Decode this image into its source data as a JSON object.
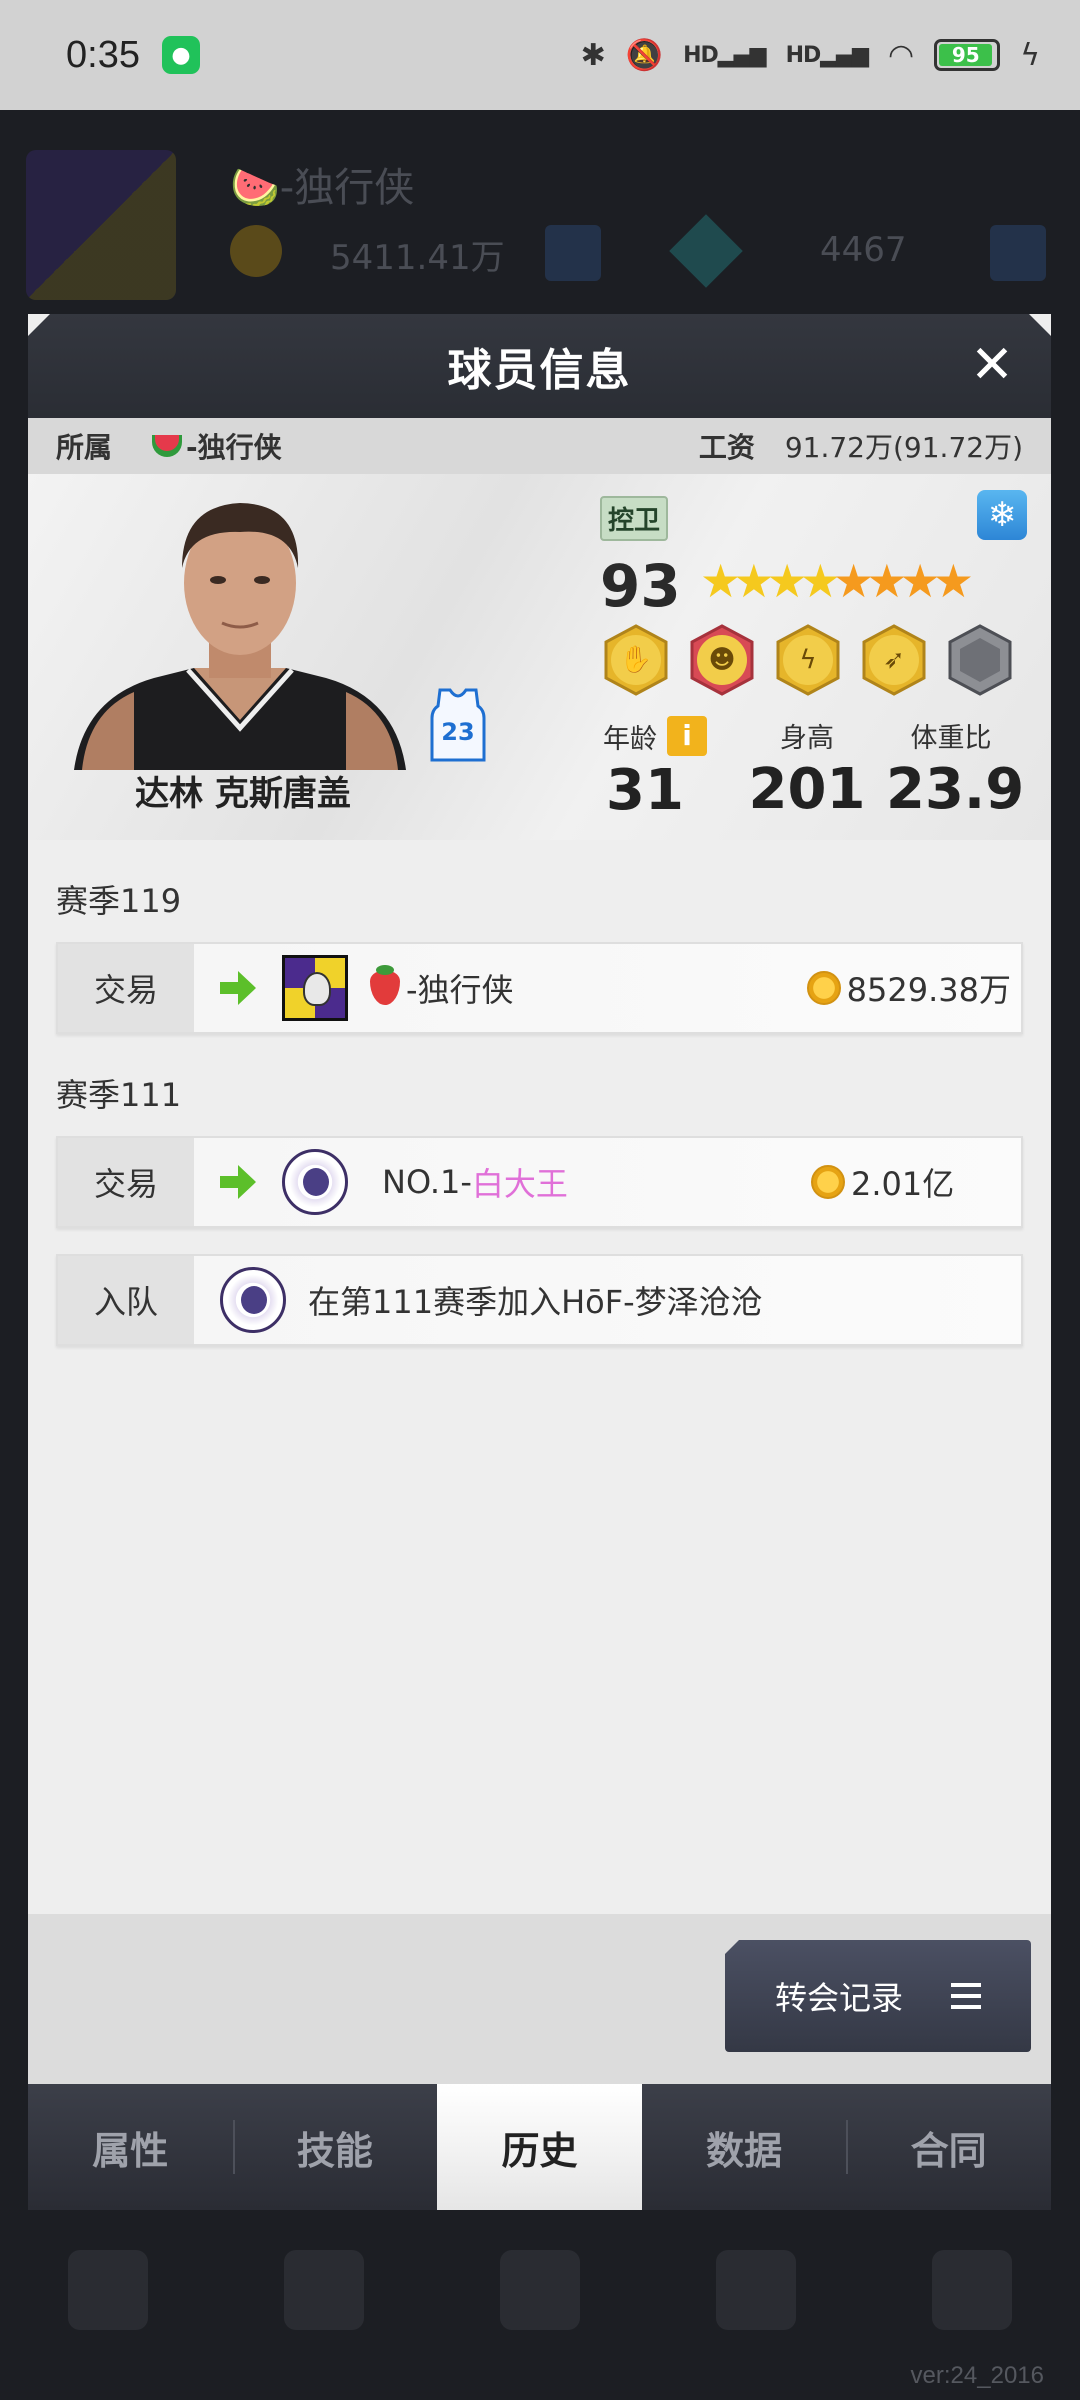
{
  "status_bar": {
    "time": "0:35",
    "network_1": "HD",
    "network_2": "HD",
    "battery": "95"
  },
  "background": {
    "team_name": "🍉-独行侠",
    "money": "5411.41万",
    "gems": "4467",
    "version": "ver:24_2016"
  },
  "dialog": {
    "title": "球员信息",
    "close_symbol": "✕",
    "affiliation_label": "所属",
    "affiliation_team": "-独行侠",
    "salary_label": "工资",
    "salary_value": "91.72万(91.72万)"
  },
  "player": {
    "name": "达林 克斯唐盖",
    "jersey_number": "23",
    "position": "控卫",
    "overall": "93",
    "stars_filled": 4,
    "stars_total": 8,
    "age_label": "年龄",
    "age": "31",
    "height_label": "身高",
    "height": "201",
    "weight_ratio_label": "体重比",
    "weight_ratio": "23.9",
    "info_symbol": "i"
  },
  "history": {
    "seasons": [
      {
        "label": "赛季119",
        "records": [
          {
            "type": "交易",
            "team": "-独行侠",
            "fee": "8529.38万"
          }
        ]
      },
      {
        "label": "赛季111",
        "records": [
          {
            "type": "交易",
            "team_prefix": "NO.1-",
            "team_highlight": "白大王",
            "fee": "2.01亿"
          },
          {
            "type": "入队",
            "text": "在第111赛季加入HōF-梦泽沧沧"
          }
        ]
      }
    ]
  },
  "buttons": {
    "transfer_record": "转会记录"
  },
  "tabs": [
    {
      "label": "属性"
    },
    {
      "label": "技能"
    },
    {
      "label": "历史"
    },
    {
      "label": "数据"
    },
    {
      "label": "合同"
    }
  ],
  "colors": {
    "highlight_pink": "#e070d8",
    "accent_green": "#5cbf2a",
    "coin_gold": "#ffd14a"
  }
}
